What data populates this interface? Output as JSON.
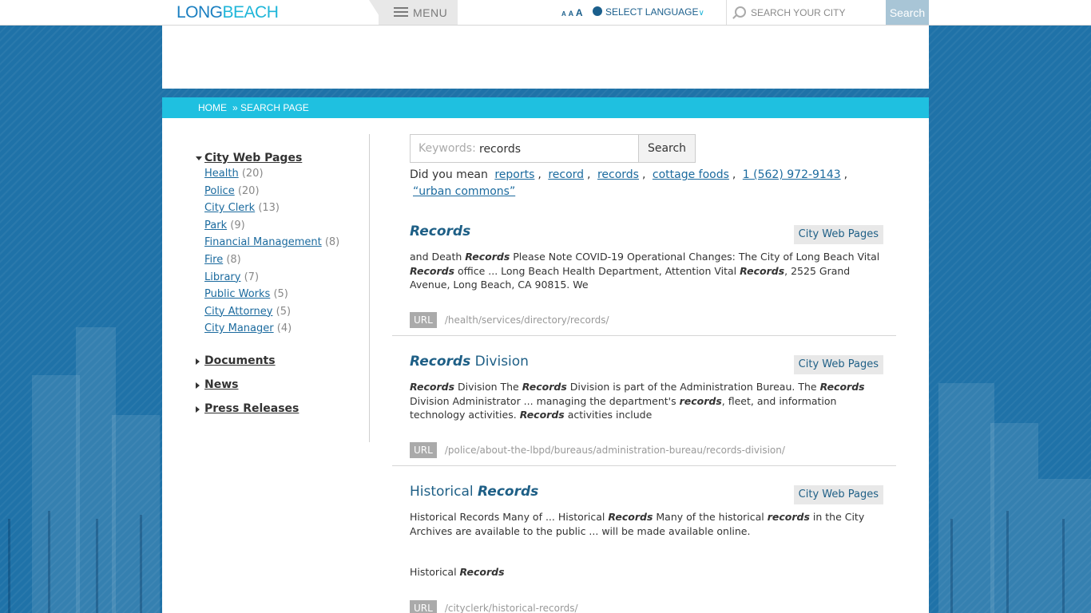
{
  "header": {
    "logo_long": "LONG",
    "logo_beach": "BEACH",
    "menu_label": "MENU",
    "font_size_small": "A",
    "font_size_mid": "A",
    "font_size_big": "A",
    "language_label": "SELECT LANGUAGE",
    "search_placeholder": "SEARCH YOUR CITY",
    "search_button": "Search"
  },
  "breadcrumb": {
    "home": "HOME",
    "current": "» SEARCH PAGE"
  },
  "sidebar": {
    "groups": [
      {
        "label": "City Web Pages",
        "expanded": true,
        "items": [
          {
            "label": "Health",
            "count": "(20)"
          },
          {
            "label": "Police",
            "count": "(20)"
          },
          {
            "label": "City Clerk",
            "count": "(13)"
          },
          {
            "label": "Park",
            "count": "(9)"
          },
          {
            "label": "Financial Management",
            "count": "(8)"
          },
          {
            "label": "Fire",
            "count": "(8)"
          },
          {
            "label": "Library",
            "count": "(7)"
          },
          {
            "label": "Public Works",
            "count": "(5)"
          },
          {
            "label": "City Attorney",
            "count": "(5)"
          },
          {
            "label": "City Manager",
            "count": "(4)"
          }
        ]
      },
      {
        "label": "Documents",
        "expanded": false
      },
      {
        "label": "News",
        "expanded": false
      },
      {
        "label": "Press Releases",
        "expanded": false
      }
    ]
  },
  "search": {
    "keywords_label": "Keywords:",
    "value": "records",
    "button": "Search",
    "did_you_mean_label": "Did you mean",
    "suggestions": [
      "reports",
      "record",
      "records",
      "cottage foods",
      "1 (562) 972-9143",
      "“urban commons”"
    ]
  },
  "results": [
    {
      "title_pre": "",
      "title_bold": "Records",
      "title_post": "",
      "tag": "City Web Pages",
      "snippet": [
        {
          "t": "and Death "
        },
        {
          "b": "Records"
        },
        {
          "t": " Please Note COVID-19 Operational Changes: The City of Long Beach Vital "
        },
        {
          "b": "Records"
        },
        {
          "t": " office ... Long Beach Health Department, Attention Vital "
        },
        {
          "b": "Records"
        },
        {
          "t": ", 2525 Grand Avenue, Long Beach, CA  90815.  We"
        }
      ],
      "url_label": "URL",
      "url": "/health/services/directory/records/"
    },
    {
      "title_pre": "",
      "title_bold": "Records",
      "title_post": " Division",
      "tag": "City Web Pages",
      "snippet": [
        {
          "b": "Records"
        },
        {
          "t": " Division The "
        },
        {
          "b": "Records"
        },
        {
          "t": " Division is part of the Administration Bureau. The "
        },
        {
          "b": "Records"
        },
        {
          "t": " Division Administrator ... managing the department's "
        },
        {
          "b": "records"
        },
        {
          "t": ", fleet, and information technology activities. "
        },
        {
          "b": "Records"
        },
        {
          "t": " activities include"
        }
      ],
      "url_label": "URL",
      "url": "/police/about-the-lbpd/bureaus/administration-bureau/records-division/"
    },
    {
      "title_pre": "Historical ",
      "title_bold": "Records",
      "title_post": "",
      "tag": "City Web Pages",
      "snippet": [
        {
          "t": "Historical Records   Many of ... Historical "
        },
        {
          "b": "Records"
        },
        {
          "t": "   Many of the historical "
        },
        {
          "b": "records"
        },
        {
          "t": " in the City Archives are available to the public ... will be made available online."
        }
      ],
      "snippet2": [
        {
          "t": "Historical "
        },
        {
          "b": "Records"
        }
      ],
      "url_label": "URL",
      "url": "/cityclerk/historical-records/"
    }
  ]
}
